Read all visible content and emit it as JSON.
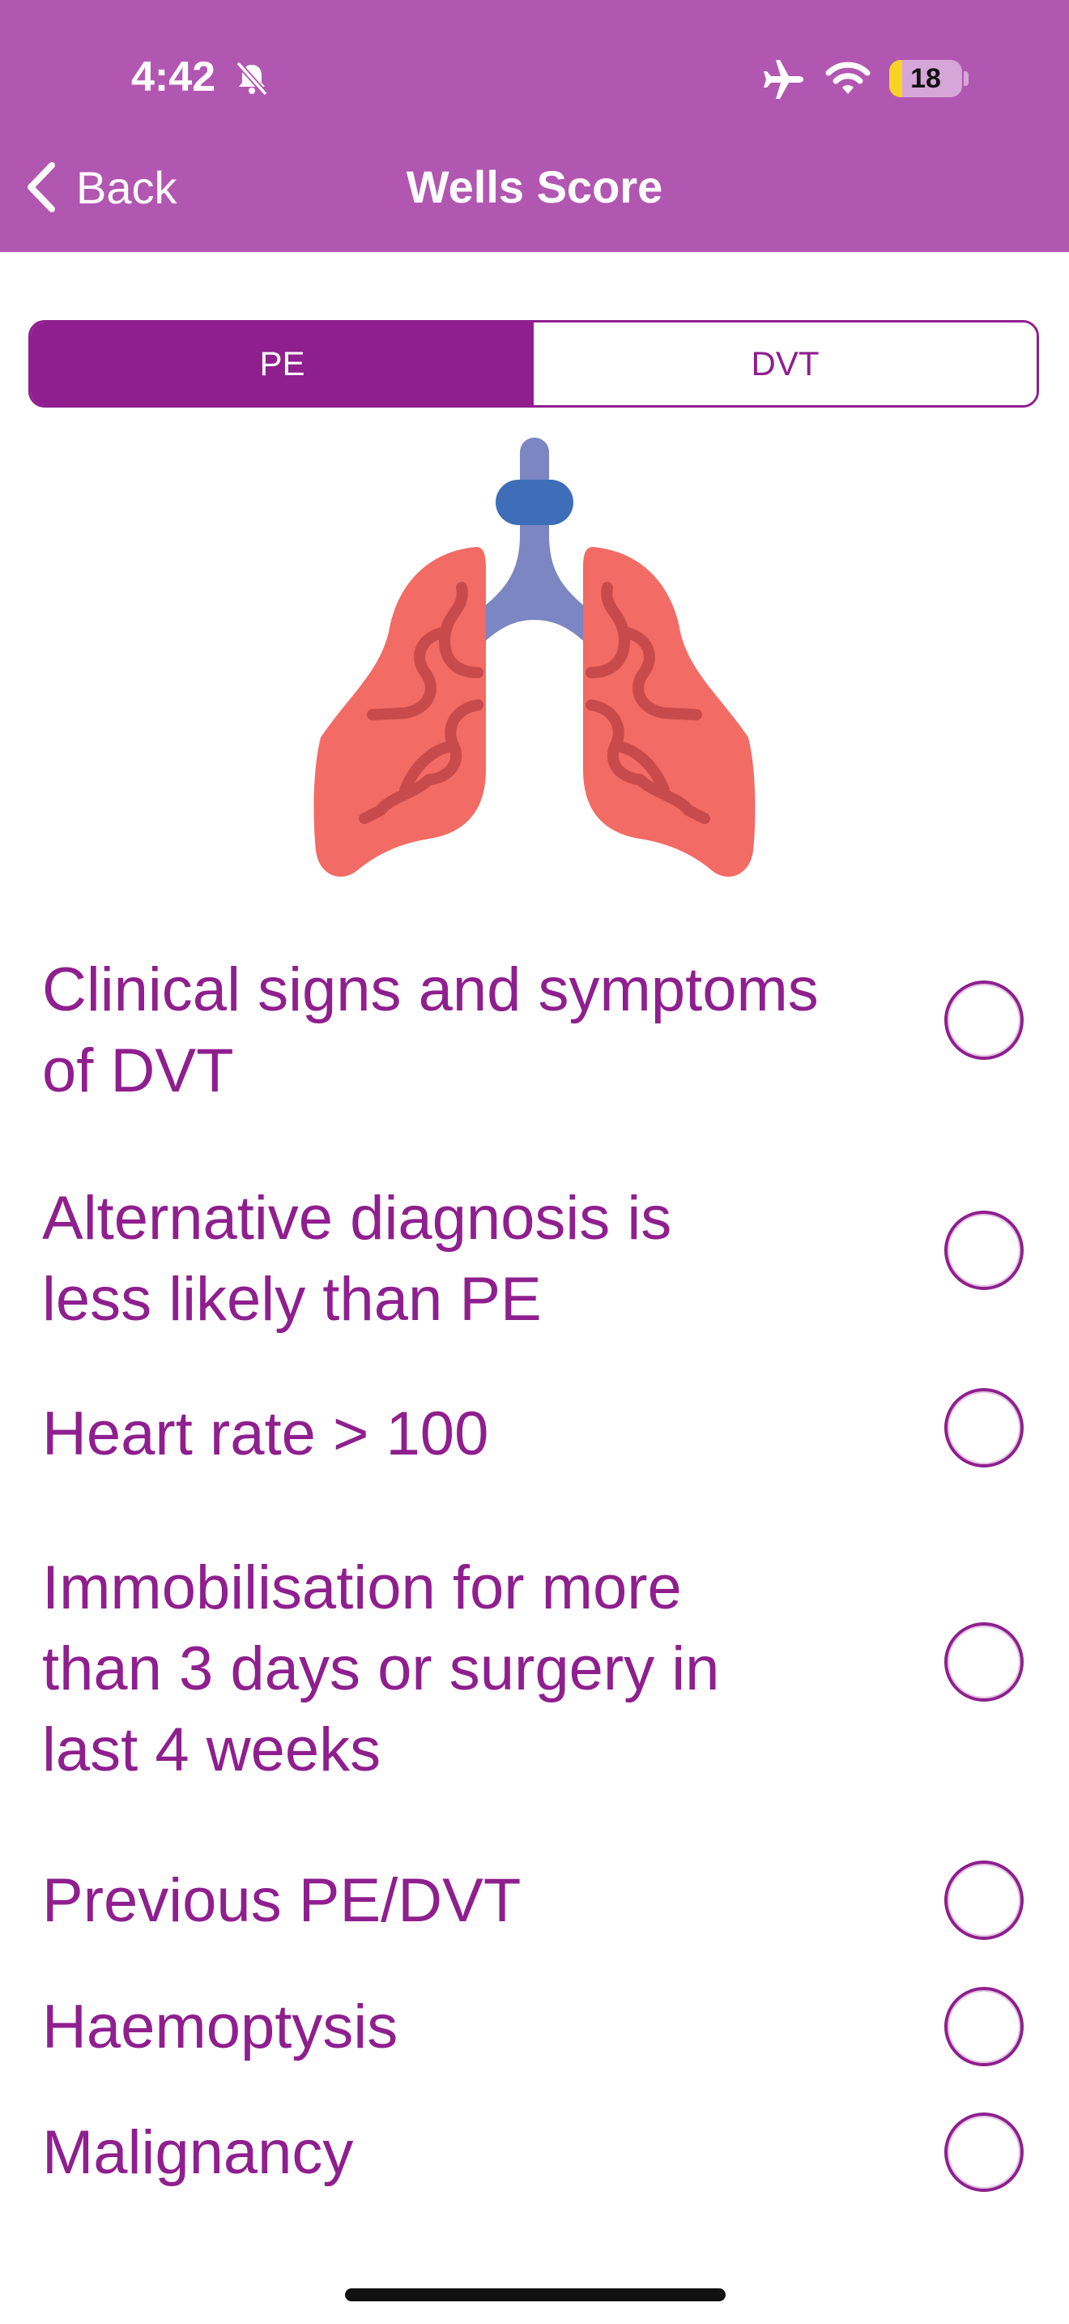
{
  "status_bar": {
    "time": "4:42",
    "battery": "18",
    "battery_fraction": 0.18,
    "icons": [
      "bell-slash-icon",
      "airplane-icon",
      "wifi-icon",
      "battery-icon"
    ]
  },
  "nav": {
    "back_label": "Back",
    "title": "Wells Score"
  },
  "tabs": [
    {
      "label": "PE",
      "active": true
    },
    {
      "label": "DVT",
      "active": false
    }
  ],
  "illustration": "lungs-icon",
  "criteria": [
    {
      "label": "Clinical signs and symptoms of DVT",
      "checked": false
    },
    {
      "label": "Alternative diagnosis is less likely than PE",
      "checked": false
    },
    {
      "label": "Heart rate > 100",
      "checked": false
    },
    {
      "label": "Immobilisation for more than 3 days or surgery in  last 4 weeks",
      "checked": false
    },
    {
      "label": "Previous PE/DVT",
      "checked": false
    },
    {
      "label": "Haemoptysis",
      "checked": false
    },
    {
      "label": "Malignancy",
      "checked": false
    }
  ],
  "colors": {
    "header": "#b257b1",
    "accent": "#8f1f8e",
    "lung": "#f26b64",
    "lung_vessel": "#c94a4a",
    "trachea": "#7b86c2",
    "trachea_ring": "#3f6eb8"
  }
}
